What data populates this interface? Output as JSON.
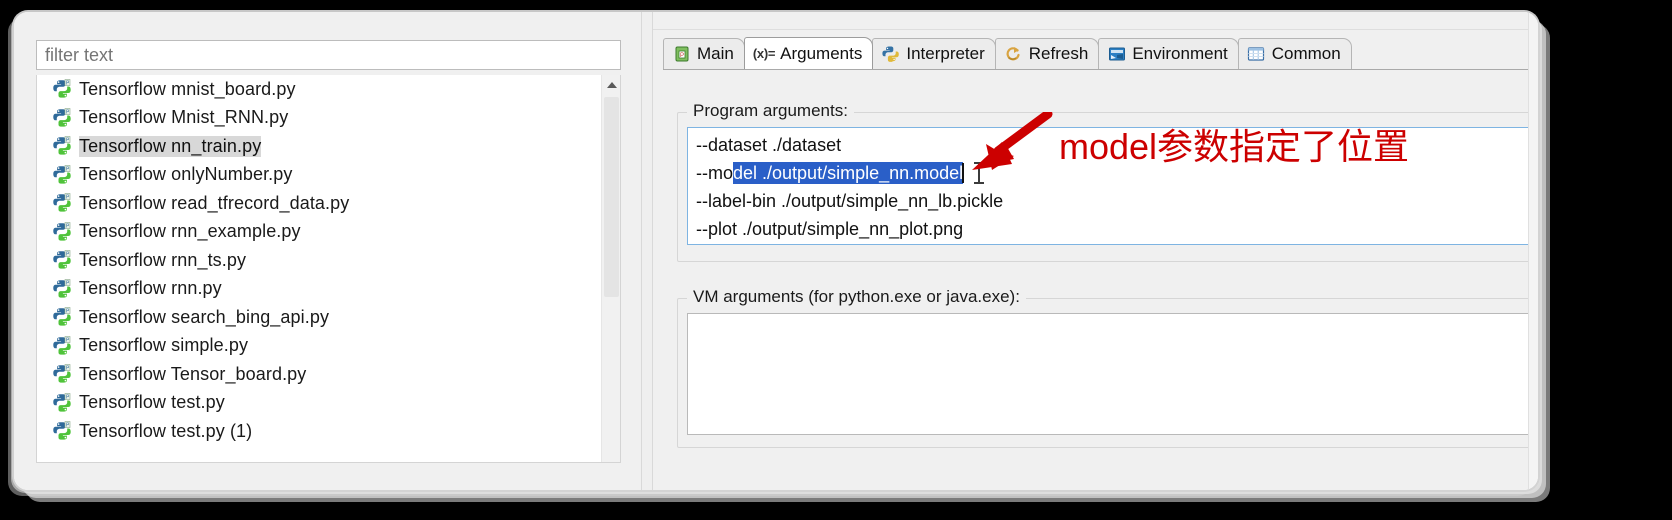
{
  "filter": {
    "placeholder": "filter text",
    "value": ""
  },
  "launch_list": {
    "items": [
      {
        "label": "Tensorflow mnist_board.py",
        "icon": "python-file-icon",
        "selected": false
      },
      {
        "label": "Tensorflow Mnist_RNN.py",
        "icon": "python-file-icon",
        "selected": false
      },
      {
        "label": "Tensorflow nn_train.py",
        "icon": "python-file-icon",
        "selected": true
      },
      {
        "label": "Tensorflow onlyNumber.py",
        "icon": "python-file-icon",
        "selected": false
      },
      {
        "label": "Tensorflow read_tfrecord_data.py",
        "icon": "python-file-icon",
        "selected": false
      },
      {
        "label": "Tensorflow rnn_example.py",
        "icon": "python-file-icon",
        "selected": false
      },
      {
        "label": "Tensorflow rnn_ts.py",
        "icon": "python-file-icon",
        "selected": false
      },
      {
        "label": "Tensorflow rnn.py",
        "icon": "python-file-icon",
        "selected": false
      },
      {
        "label": "Tensorflow search_bing_api.py",
        "icon": "python-file-icon",
        "selected": false
      },
      {
        "label": "Tensorflow simple.py",
        "icon": "python-file-icon",
        "selected": false
      },
      {
        "label": "Tensorflow Tensor_board.py",
        "icon": "python-file-icon",
        "selected": false
      },
      {
        "label": "Tensorflow test.py",
        "icon": "python-file-icon",
        "selected": false
      },
      {
        "label": "Tensorflow test.py (1)",
        "icon": "python-file-icon",
        "selected": false
      }
    ],
    "scrollbar": {
      "up_arrow_icon": "chevron-up-icon"
    }
  },
  "tabs": [
    {
      "label": "Main",
      "icon": "main-config-icon",
      "active": false
    },
    {
      "label": "Arguments",
      "icon": "arguments-icon",
      "marker": "(x)=",
      "active": true
    },
    {
      "label": "Interpreter",
      "icon": "python-interpreter-icon",
      "active": false
    },
    {
      "label": "Refresh",
      "icon": "refresh-icon",
      "active": false
    },
    {
      "label": "Environment",
      "icon": "environment-icon",
      "active": false
    },
    {
      "label": "Common",
      "icon": "common-icon",
      "active": false
    }
  ],
  "program_arguments": {
    "title": "Program arguments:",
    "lines": [
      {
        "text": "--dataset ./dataset",
        "selection": null
      },
      {
        "prefix": "--mo",
        "selected_text": "del ./output/simple_nn.model",
        "suffix": ""
      },
      {
        "text": "--label-bin ./output/simple_nn_lb.pickle",
        "selection": null
      },
      {
        "text": "--plot ./output/simple_nn_plot.png",
        "selection": null
      }
    ]
  },
  "vm_arguments": {
    "title": "VM arguments (for python.exe or java.exe):",
    "value": ""
  },
  "annotation": {
    "text": "model参数指定了位置",
    "color": "#cc0000",
    "arrow_icon": "red-arrow-icon"
  },
  "colors": {
    "selection_blue": "#2a5fc8",
    "focus_border": "#7eb4e2",
    "annotation_red": "#cc0000",
    "list_selected_gray": "#d8d8d8"
  }
}
